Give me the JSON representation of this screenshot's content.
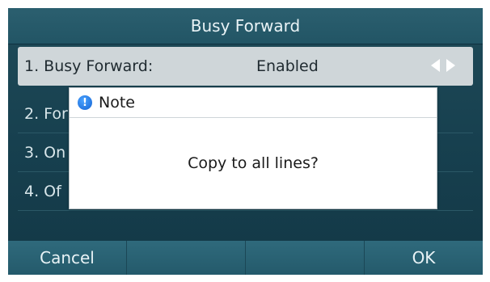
{
  "header": {
    "title": "Busy Forward"
  },
  "list": {
    "items": [
      {
        "label": "1. Busy Forward:",
        "value": "Enabled",
        "selected": true
      },
      {
        "label": "2. For",
        "value": ""
      },
      {
        "label": "3. On",
        "value": ""
      },
      {
        "label": "4. Of",
        "value": ""
      }
    ],
    "arrow_icons": [
      "left-arrow-icon",
      "right-arrow-icon"
    ]
  },
  "dialog": {
    "title": "Note",
    "message": "Copy to all lines?",
    "icon": "info-icon"
  },
  "softkeys": [
    "Cancel",
    "",
    "",
    "OK"
  ],
  "colors": {
    "screen_bg": "#17404f",
    "selected_row_bg": "#cfd6d9",
    "dialog_bg": "#ffffff"
  }
}
